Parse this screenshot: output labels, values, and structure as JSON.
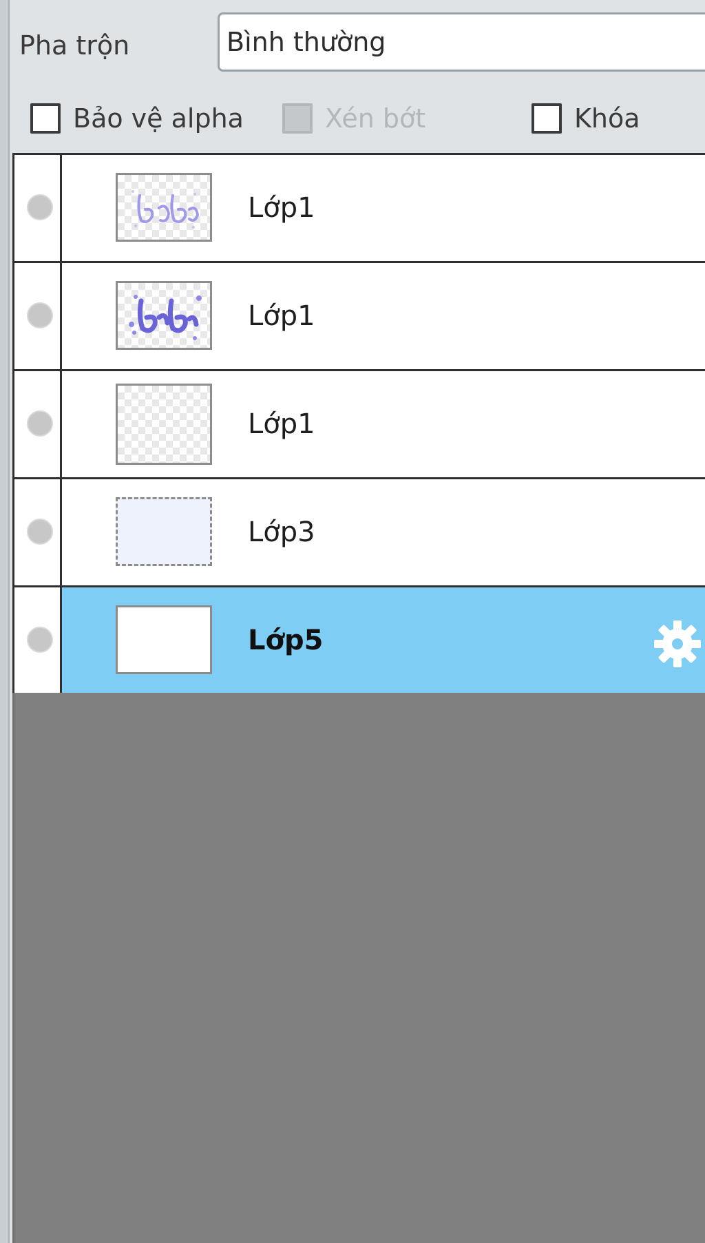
{
  "blend": {
    "label": "Pha trộn",
    "value": "Bình thường"
  },
  "options": {
    "protect_alpha": "Bảo vệ alpha",
    "clipping": "Xén bớt",
    "lock": "Khóa"
  },
  "layers": [
    {
      "name": "Lớp1",
      "thumbnail": "light-lettering",
      "selected": false
    },
    {
      "name": "Lớp1",
      "thumbnail": "bold-lettering",
      "selected": false
    },
    {
      "name": "Lớp1",
      "thumbnail": "transparent",
      "selected": false
    },
    {
      "name": "Lớp3",
      "thumbnail": "light-fill",
      "selected": false
    },
    {
      "name": "Lớp5",
      "thumbnail": "white-fill",
      "selected": true
    }
  ],
  "colors": {
    "selected_row": "#7ecdf5",
    "panel_bg": "#dfe3e6",
    "empty_area": "#808080",
    "lettering": "#6a63d8"
  },
  "icons": {
    "visibility": "visibility-dot-icon",
    "settings": "gear-icon"
  }
}
